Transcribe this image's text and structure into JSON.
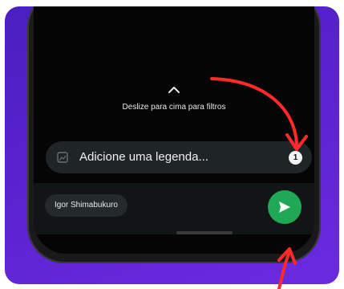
{
  "swipe_hint": {
    "text": "Deslize para cima para filtros",
    "icon": "chevron-up-icon"
  },
  "caption": {
    "placeholder": "Adicione uma legenda...",
    "media_count": "1",
    "icon": "gallery-icon"
  },
  "recipient": {
    "name": "Igor Shimabukuro"
  },
  "send": {
    "icon": "send-icon",
    "color": "#1fa855"
  },
  "colors": {
    "background": "#5a22cf",
    "annotation_arrow": "#ff2a2a"
  }
}
